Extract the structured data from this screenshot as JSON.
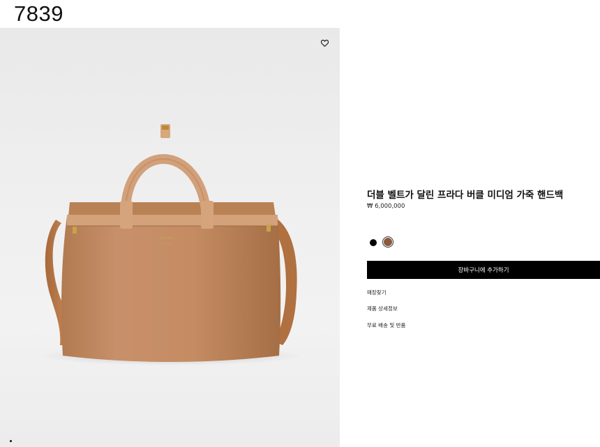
{
  "header": {
    "number": "7839"
  },
  "hero": {
    "alt": "brown leather handbag"
  },
  "product": {
    "title": "더블 벨트가 달린 프라다 버클 미디엄 가죽 핸드백",
    "price": "₩ 6,000,000",
    "colors": [
      {
        "name": "black",
        "hex": "#000000"
      },
      {
        "name": "brown",
        "hex": "#8a5a3c",
        "selected": true
      }
    ],
    "add_to_cart_label": "장바구니에 추가하기",
    "links": [
      "매장찾기",
      "제품 상세정보",
      "무료 배송 및 반품"
    ]
  },
  "colors": {
    "accent": "#000000",
    "bag_leather": "#c08a5e"
  }
}
